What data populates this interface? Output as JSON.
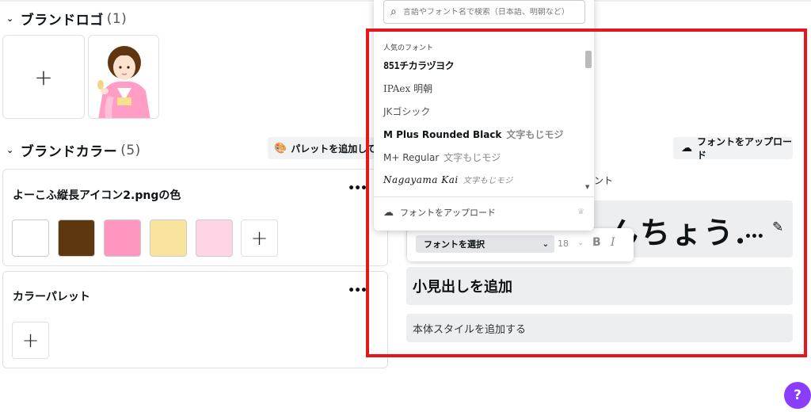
{
  "brand_logo": {
    "title": "ブランドロゴ",
    "count": "(1)"
  },
  "brand_color": {
    "title": "ブランドカラー",
    "count": "(5)",
    "palette_button": "パレットを追加して表示"
  },
  "color_cards": [
    {
      "title": "よーこふ縦長アイコン2.pngの色",
      "swatches": [
        "#ffffff",
        "#5e3711",
        "#ff96c0",
        "#f9e49d",
        "#ffd5e5"
      ]
    },
    {
      "title": "カラーパレット",
      "swatches": []
    }
  ],
  "fonts_panel": {
    "upload_button": "フォントをアップロード",
    "label_fragment": "ント",
    "heading_fragment": "んちょう.",
    "subheading": "小見出しを追加",
    "body_style": "本体スタイルを追加する"
  },
  "font_toolbar": {
    "font_select": "フォントを選択",
    "size": "18",
    "bold": "B",
    "italic": "I"
  },
  "font_dropdown": {
    "search_placeholder": "言語やフォント名で検索（日本語、明朝など）",
    "section": "人気のフォント",
    "fonts": [
      {
        "name": "851チカラヅヨク",
        "sample": ""
      },
      {
        "name": "IPAex 明朝",
        "sample": ""
      },
      {
        "name": "JKゴシック",
        "sample": ""
      },
      {
        "name": "M Plus Rounded Black",
        "sample": "文字もじモジ"
      },
      {
        "name": "M+ Regular",
        "sample": "文字もじモジ"
      },
      {
        "name": "Nagayama Kai",
        "sample": "文字もじモジ"
      }
    ],
    "upload": "フォントをアップロード"
  },
  "help_button": "?",
  "colors": {
    "highlight": "#e8161a",
    "help": "#8b3dff"
  }
}
